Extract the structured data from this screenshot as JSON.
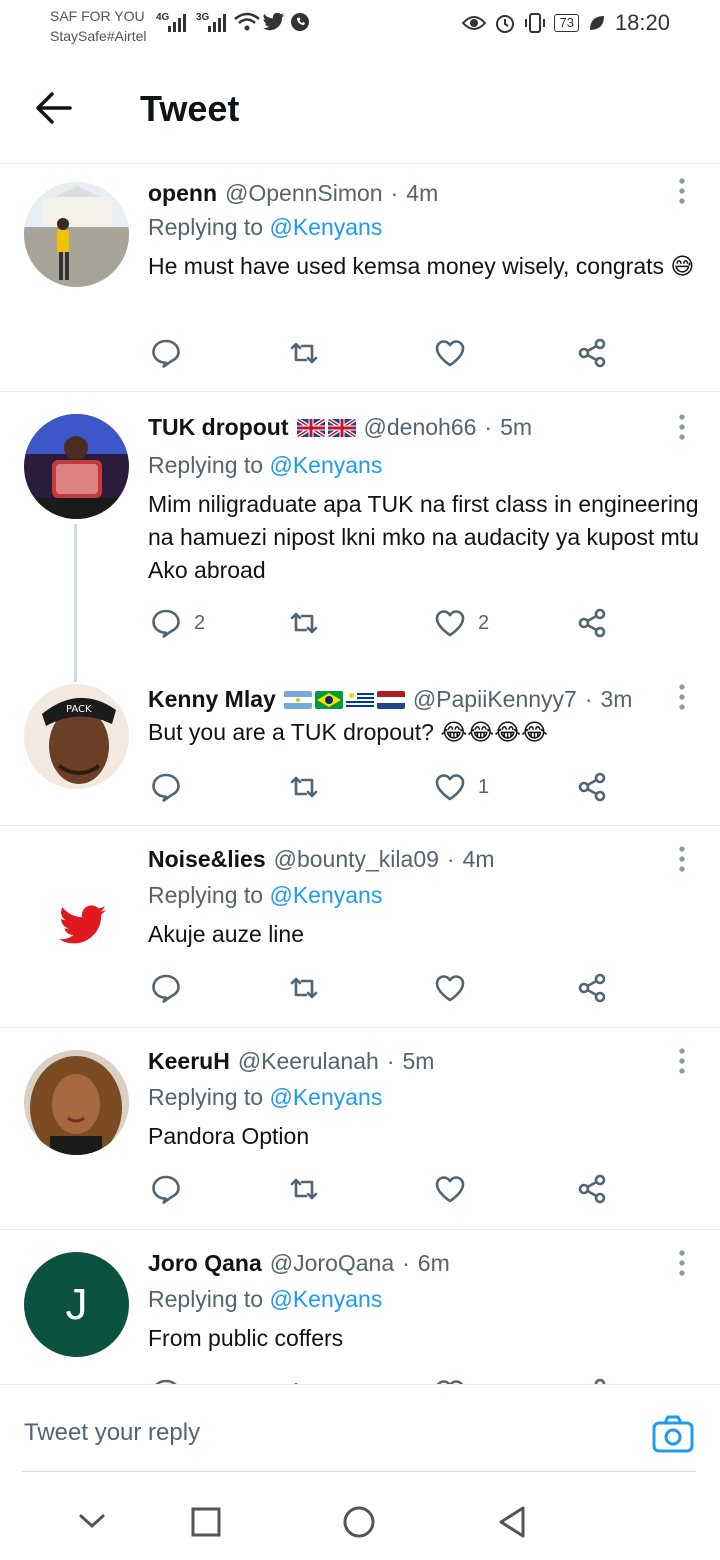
{
  "status": {
    "carrier_line1": "SAF FOR YOU",
    "carrier_line2": "StaySafe#Airtel",
    "net1": "4G",
    "net2": "3G",
    "battery": "73",
    "time": "18:20"
  },
  "header": {
    "title": "Tweet"
  },
  "tweets": [
    {
      "name": "openn",
      "handle": "@OpennSimon",
      "time": "4m",
      "replying_prefix": "Replying to",
      "mention": "@Kenyans",
      "text": "He must have used kemsa money wisely, congrats 😅",
      "replies": "",
      "likes": ""
    },
    {
      "name": "TUK dropout",
      "handle": "@denoh66",
      "time": "5m",
      "replying_prefix": "Replying to",
      "mention": "@Kenyans",
      "text": "Mim niligraduate apa TUK na first class in engineering na hamuezi nipost lkni mko na audacity ya kupost mtu Ako abroad",
      "replies": "2",
      "likes": "2"
    },
    {
      "name": "Kenny Mlay",
      "handle": "@PapiiKennyy7",
      "time": "3m",
      "text": "But you are a TUK dropout? 😂😂😂😂",
      "replies": "",
      "likes": "1"
    },
    {
      "name": "Noise&lies",
      "handle": "@bounty_kila09",
      "time": "4m",
      "replying_prefix": "Replying to",
      "mention": "@Kenyans",
      "text": "Akuje auze line",
      "replies": "",
      "likes": ""
    },
    {
      "name": "KeeruH",
      "handle": "@Keerulanah",
      "time": "5m",
      "replying_prefix": "Replying to",
      "mention": "@Kenyans",
      "text": "Pandora Option",
      "replies": "",
      "likes": ""
    },
    {
      "name": "Joro Qana",
      "handle": "@JoroQana",
      "time": "6m",
      "replying_prefix": "Replying to",
      "mention": "@Kenyans",
      "text": "From public coffers",
      "avatar_letter": "J"
    }
  ],
  "reply_bar": {
    "placeholder": "Tweet your reply"
  },
  "colors": {
    "accent": "#1d9bf0",
    "text": "#0f1419",
    "muted": "#536471",
    "joro_avatar": "#0b5240",
    "twitter_red": "#e0191f"
  }
}
